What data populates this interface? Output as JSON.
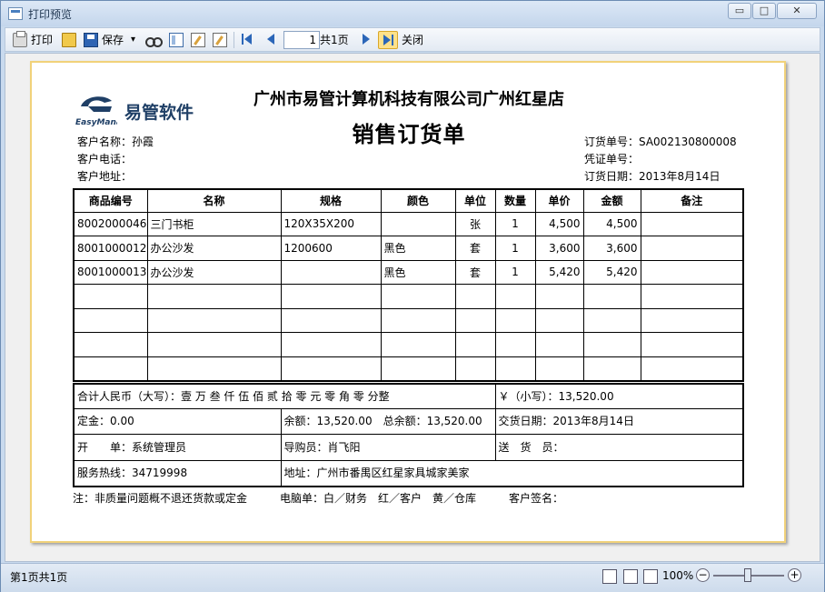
{
  "window": {
    "title": "打印预览",
    "min_glyph": "▭",
    "max_glyph": "□",
    "close_glyph": "✕"
  },
  "toolbar": {
    "print_label": "打印",
    "save_label": "保存",
    "save_dropdown": "▾",
    "page_input": "1",
    "page_total": "共1页",
    "close_label": "关闭"
  },
  "document": {
    "logo_text": "易管软件",
    "logo_sub": "EasyManage",
    "company": "广州市易管计算机科技有限公司广州红星店",
    "title": "销售订货单",
    "customer_name": "客户名称：孙霞",
    "customer_phone": "客户电话：",
    "customer_address": "客户地址：",
    "order_no": "订货单号：SA002130800008",
    "voucher_no": "凭证单号：",
    "order_date": "订货日期：2013年8月14日",
    "columns": [
      "商品编号",
      "名称",
      "规格",
      "颜色",
      "单位",
      "数量",
      "单价",
      "金额",
      "备注"
    ],
    "rows": [
      [
        "8002000046",
        "三门书柜",
        "120X35X200",
        "",
        "张",
        "1",
        "4,500",
        "4,500",
        ""
      ],
      [
        "8001000012",
        "办公沙发",
        "1200600",
        "黑色",
        "套",
        "1",
        "3,600",
        "3,600",
        ""
      ],
      [
        "8001000013",
        "办公沙发",
        "",
        "黑色",
        "套",
        "1",
        "5,420",
        "5,420",
        ""
      ],
      [
        "",
        "",
        "",
        "",
        "",
        "",
        "",
        "",
        ""
      ],
      [
        "",
        "",
        "",
        "",
        "",
        "",
        "",
        "",
        ""
      ],
      [
        "",
        "",
        "",
        "",
        "",
        "",
        "",
        "",
        ""
      ],
      [
        "",
        "",
        "",
        "",
        "",
        "",
        "",
        "",
        ""
      ]
    ],
    "total_upper": "合计人民币（大写）：壹 万 叁 仟 伍 佰 贰 拾 零 元 零 角 零 分整",
    "total_lower": "￥（小写）：13,520.00",
    "deposit": "定金：0.00",
    "balance": "余额：13,520.00　总余额：13,520.00",
    "delivery_date": "交货日期：2013年8月14日",
    "issuer": "开　　单：系统管理员",
    "guide": "导购员：肖飞阳",
    "deliverer": "送　货　员：",
    "hotline": "服务热线：34719998",
    "address": "地址：广州市番禺区红星家具城家美家",
    "footnote": "注：非质量问题概不退还货款或定金　　　电脑单：白／财务　红／客户　黄／仓库　　　客户签名："
  },
  "status": {
    "page_text": "第1页共1页",
    "zoom": "100%",
    "zoom_minus": "−",
    "zoom_plus": "+"
  }
}
